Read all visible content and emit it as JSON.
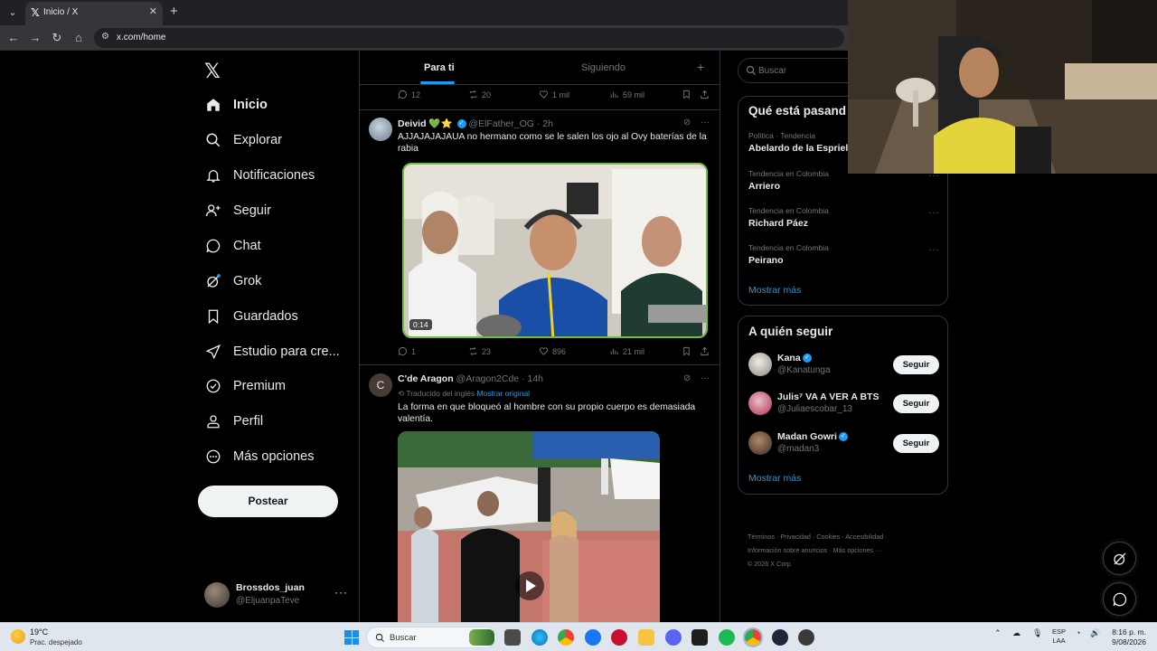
{
  "browser": {
    "tab_title": "Inicio / X",
    "url": "x.com/home"
  },
  "nav": {
    "logo": "𝕏",
    "items": [
      {
        "label": "Inicio",
        "icon": "home-icon",
        "active": true
      },
      {
        "label": "Explorar",
        "icon": "search-icon"
      },
      {
        "label": "Notificaciones",
        "icon": "bell-icon"
      },
      {
        "label": "Seguir",
        "icon": "person-plus-icon"
      },
      {
        "label": "Chat",
        "icon": "chat-icon"
      },
      {
        "label": "Grok",
        "icon": "grok-icon"
      },
      {
        "label": "Guardados",
        "icon": "bookmark-icon"
      },
      {
        "label": "Estudio para cre...",
        "icon": "rocket-icon"
      },
      {
        "label": "Premium",
        "icon": "premium-icon"
      },
      {
        "label": "Perfil",
        "icon": "person-icon"
      },
      {
        "label": "Más opciones",
        "icon": "more-circle-icon"
      }
    ],
    "post_button": "Postear",
    "account": {
      "name": "Brossdos_juan",
      "handle": "@EljuanpaTeve"
    }
  },
  "timeline": {
    "tabs": [
      "Para ti",
      "Siguiendo"
    ],
    "top_actions": {
      "replies": "12",
      "reposts": "20",
      "likes": "1 mil",
      "views": "59 mil"
    },
    "posts": [
      {
        "name": "Deivid 💚⭐",
        "handle": "@ElFather_OG",
        "time": "· 2h",
        "text": "AJJAJAJAJAUA no hermano como se le salen los ojo al Ovy baterías de la rabia",
        "video_duration": "0:14",
        "actions": {
          "replies": "1",
          "reposts": "23",
          "likes": "896",
          "views": "21 mil"
        }
      },
      {
        "name": "C'de Aragon",
        "handle": "@Aragon2Cde",
        "time": "· 14h",
        "translated": "Traducido del inglés",
        "show_original": "Mostrar original",
        "text": "La forma en que bloqueó al hombre con su propio cuerpo es demasiada valentía.",
        "avatar_letter": "C"
      }
    ]
  },
  "right": {
    "search_placeholder": "Buscar",
    "trends_title": "Qué está pasand",
    "trends": [
      {
        "context": "Política · Tendencia",
        "name": "Abelardo de la Espriella"
      },
      {
        "context": "Tendencia en Colombia",
        "name": "Arriero"
      },
      {
        "context": "Tendencia en Colombia",
        "name": "Richard Páez"
      },
      {
        "context": "Tendencia en Colombia",
        "name": "Peirano"
      }
    ],
    "trends_more": "Mostrar más",
    "follow_title": "A quién seguir",
    "follow": [
      {
        "name": "Kana",
        "handle": "@Kanatunga",
        "button": "Seguir"
      },
      {
        "name": "Julis⁷ VA A VER A BTS",
        "handle": "@Juliaescobar_13",
        "button": "Seguir"
      },
      {
        "name": "Madan Gowri",
        "handle": "@madan3",
        "button": "Seguir"
      }
    ],
    "follow_more": "Mostrar más",
    "footer_line1": "Términos  ·  Privacidad  ·  Cookies  ·  Accesibilidad  ·",
    "footer_line2": "Información sobre anuncios  ·  Más opciones ···",
    "footer_line3": "© 2026 X Corp."
  },
  "taskbar": {
    "temp": "19°C",
    "weather": "Prac. despejado",
    "search": "Buscar",
    "lang1": "ESP",
    "lang2": "LAA",
    "time": "8:16 p. m.",
    "date": "9/08/2026"
  },
  "colors": {
    "accent": "#1d9bf0",
    "bg": "#000000",
    "border": "#2f3336",
    "muted": "#71767b"
  }
}
